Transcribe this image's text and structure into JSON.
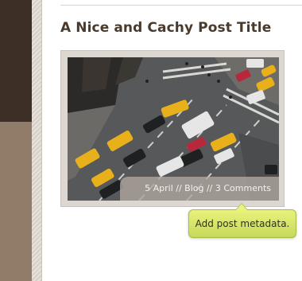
{
  "post": {
    "title": "A Nice and Cachy Post Title",
    "meta": "5 April // Blog // 3 Comments"
  },
  "tooltip": {
    "text": "Add post metadata."
  },
  "colors": {
    "sidebar_dark": "#3d2f25",
    "sidebar_light": "#917c6a",
    "title": "#4a3a2c",
    "tooltip_bg": "#dde96e"
  }
}
